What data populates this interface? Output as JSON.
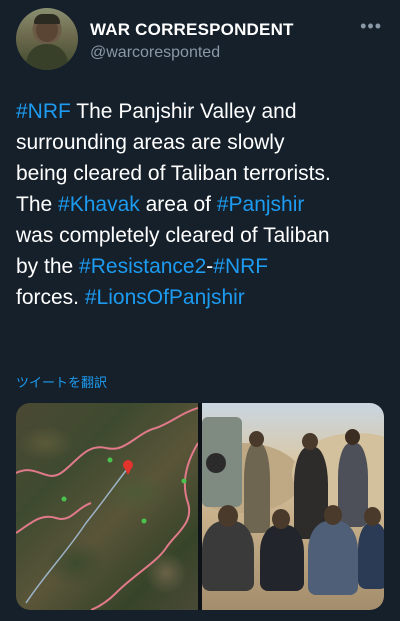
{
  "header": {
    "display_name": "WAR CORRESPONDENT",
    "handle": "@warcoresponted",
    "more_icon": "more-horizontal-icon"
  },
  "tweet": {
    "lines": [
      [
        {
          "t": "#NRF",
          "tag": true
        },
        {
          "t": " The Panjshir Valley and",
          "tag": false
        }
      ],
      [
        {
          "t": "surrounding areas are slowly",
          "tag": false
        }
      ],
      [
        {
          "t": "being cleared of Taliban terrorists.",
          "tag": false
        }
      ],
      [
        {
          "t": "The ",
          "tag": false
        },
        {
          "t": "#Khavak",
          "tag": true
        },
        {
          "t": " area of ",
          "tag": false
        },
        {
          "t": "#Panjshir",
          "tag": true
        }
      ],
      [
        {
          "t": "was completely cleared of Taliban",
          "tag": false
        }
      ],
      [
        {
          "t": "by the ",
          "tag": false
        },
        {
          "t": "#Resistance2",
          "tag": true
        },
        {
          "t": "-",
          "tag": false
        },
        {
          "t": "#NRF",
          "tag": true
        }
      ],
      [
        {
          "t": "forces. ",
          "tag": false
        },
        {
          "t": "#LionsOfPanjshir",
          "tag": true
        }
      ]
    ],
    "translate_label": "ツイートを翻訳"
  },
  "colors": {
    "background": "#15202b",
    "link": "#1d9bf0",
    "secondary_text": "#8b98a5"
  },
  "media": {
    "map_image": "satellite-map",
    "photo_image": "group-photo"
  }
}
